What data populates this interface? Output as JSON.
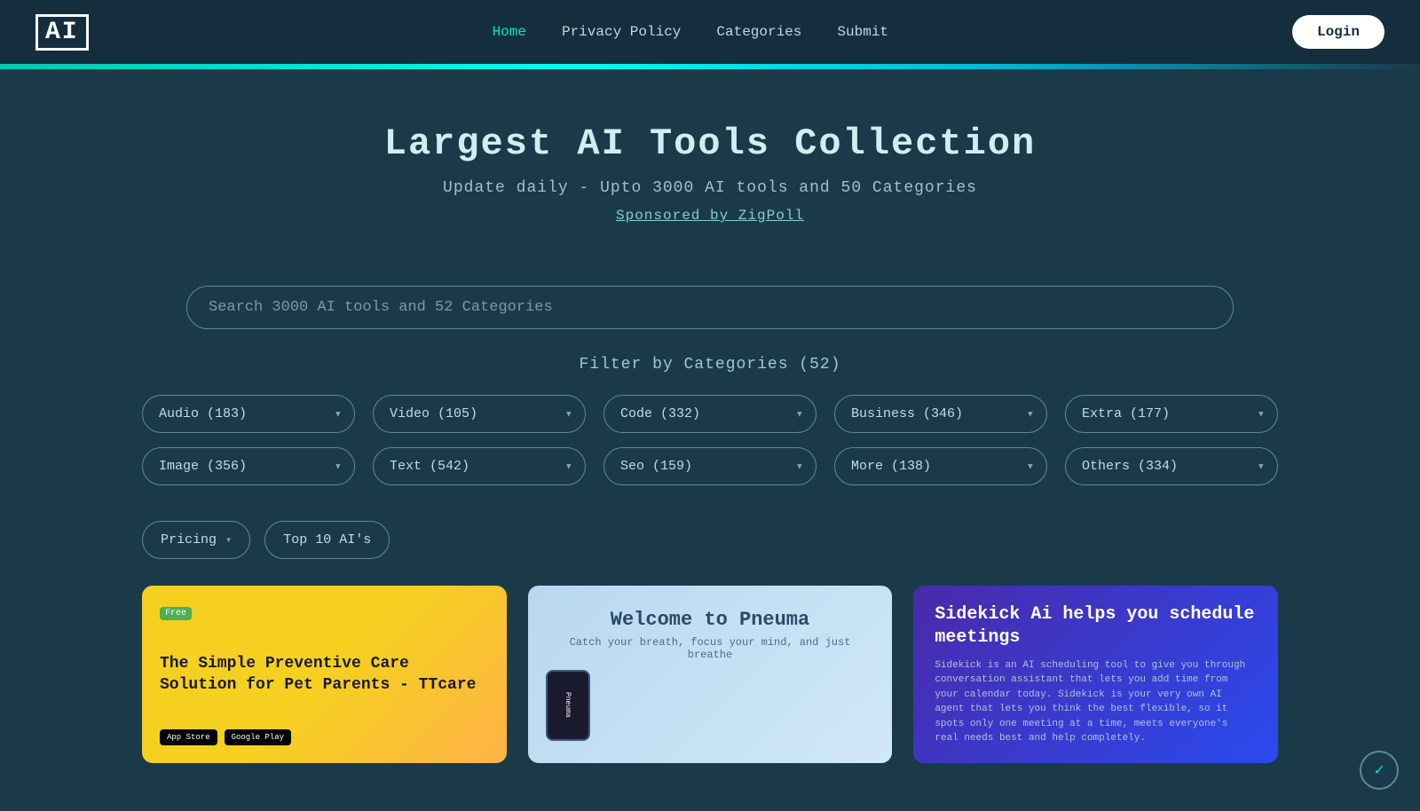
{
  "navbar": {
    "logo": "AI",
    "links": [
      {
        "label": "Home",
        "active": true
      },
      {
        "label": "Privacy Policy",
        "active": false
      },
      {
        "label": "Categories",
        "active": false
      },
      {
        "label": "Submit",
        "active": false
      }
    ],
    "login_label": "Login"
  },
  "hero": {
    "title": "Largest AI Tools Collection",
    "subtitle": "Update daily - Upto 3000 AI tools and 50 Categories",
    "sponsor_text": "Sponsored by ZigPoll"
  },
  "search": {
    "placeholder": "Search 3000 AI tools and 52 Categories"
  },
  "filter": {
    "label": "Filter by Categories (52)",
    "categories_row1": [
      {
        "label": "Audio (183)",
        "value": "audio"
      },
      {
        "label": "Video (105)",
        "value": "video"
      },
      {
        "label": "Code (332)",
        "value": "code"
      },
      {
        "label": "Business (346)",
        "value": "business"
      },
      {
        "label": "Extra (177)",
        "value": "extra"
      }
    ],
    "categories_row2": [
      {
        "label": "Image (356)",
        "value": "image"
      },
      {
        "label": "Text (542)",
        "value": "text"
      },
      {
        "label": "Seo (159)",
        "value": "seo"
      },
      {
        "label": "More (138)",
        "value": "more"
      },
      {
        "label": "Others (334)",
        "value": "others"
      }
    ]
  },
  "filter_buttons": {
    "pricing_label": "Pricing",
    "top10_label": "Top 10 AI's"
  },
  "cards": [
    {
      "id": "card-1",
      "badge": "Free",
      "title": "The Simple Preventive Care Solution for Pet Parents - TTcare",
      "store1": "App Store",
      "store2": "Google Play",
      "bg": "yellow"
    },
    {
      "id": "card-2",
      "title": "Welcome to Pneuma",
      "subtitle": "Catch your breath, focus your mind, and just breathe",
      "phone_label": "Pneuma",
      "bg": "light-blue"
    },
    {
      "id": "card-3",
      "title": "Sidekick Ai helps you schedule meetings",
      "description": "Sidekick is an AI scheduling tool to give you through conversation assistant that lets you add time from your calendar today. Sidekick is your very own AI agent that lets you think the best flexible, so it spots only one meeting at a time, meets everyone's real needs best and help completely.",
      "bg": "purple-blue"
    }
  ],
  "floating": {
    "check_icon": "✓"
  }
}
